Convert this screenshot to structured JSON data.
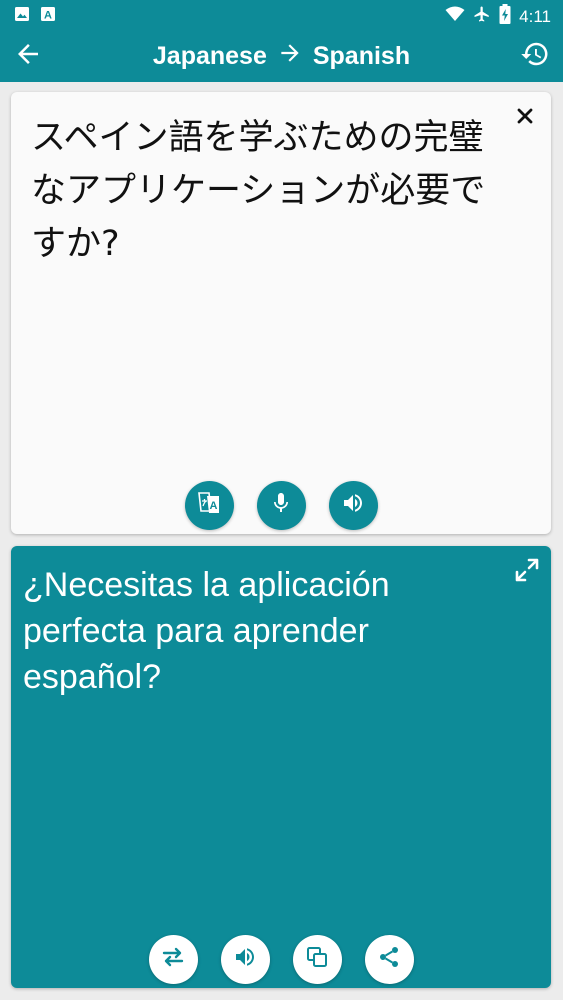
{
  "status_bar": {
    "time": "4:11",
    "left_icons": [
      "image-icon",
      "translate-a-icon"
    ],
    "right_icons": [
      "wifi-icon",
      "airplane-icon",
      "battery-charging-icon"
    ]
  },
  "app_bar": {
    "source_language": "Japanese",
    "target_language": "Spanish",
    "arrow_icon": "arrow-right-icon",
    "back_icon": "arrow-left-icon",
    "history_icon": "history-icon"
  },
  "input_card": {
    "text": "スペイン語を学ぶための完璧なアプリケーションが必要ですか?",
    "clear_icon": "close-icon",
    "actions": [
      "translate-icon",
      "microphone-icon",
      "volume-icon"
    ]
  },
  "output_card": {
    "text": "¿Necesitas la aplicación perfecta para aprender español?",
    "expand_icon": "expand-icon",
    "actions": [
      "swap-icon",
      "volume-icon",
      "copy-icon",
      "share-icon"
    ]
  },
  "colors": {
    "primary": "#0d8b98",
    "background": "#ececec",
    "card": "#fafafa"
  }
}
